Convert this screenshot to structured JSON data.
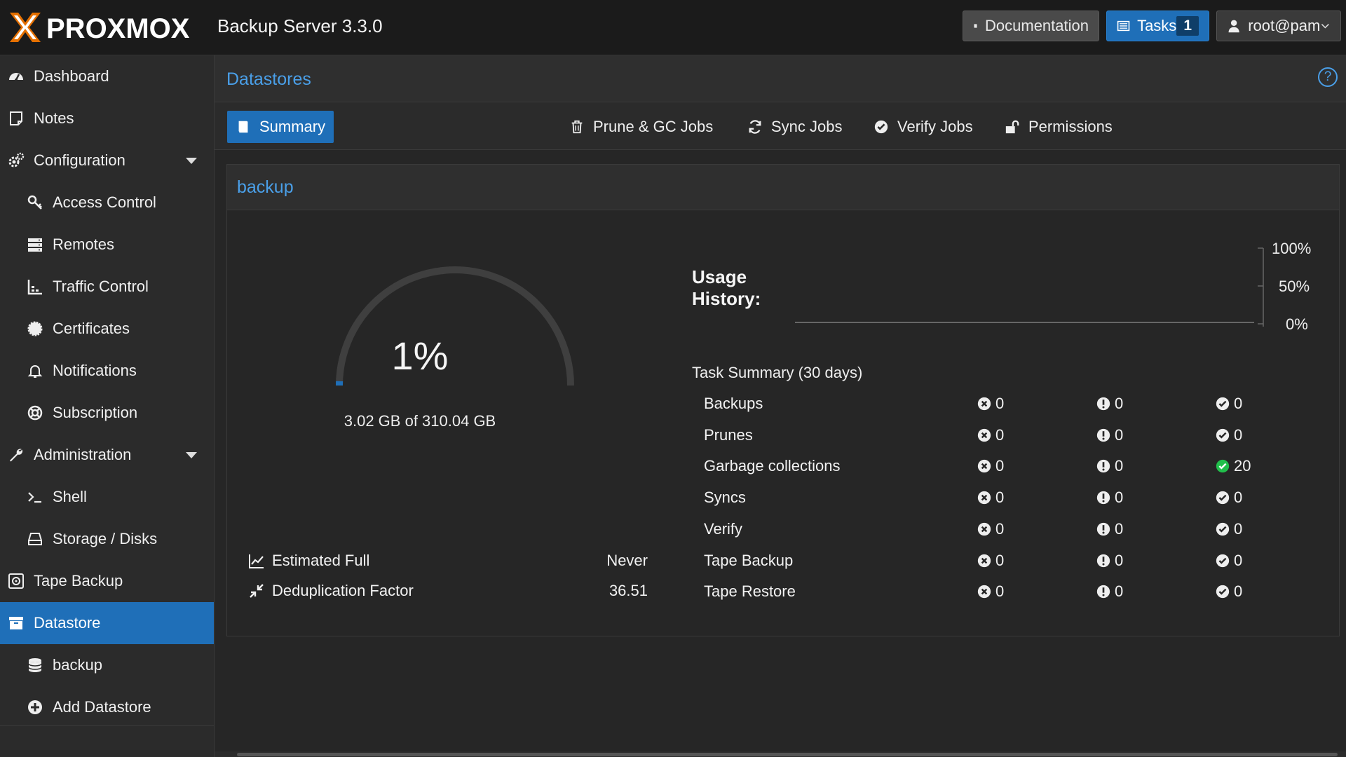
{
  "header": {
    "logo_text": "PROXMOX",
    "product": "Backup Server 3.3.0",
    "documentation_label": "Documentation",
    "tasks_label": "Tasks",
    "tasks_count": "1",
    "user_label": "root@pam"
  },
  "sidebar": {
    "items": [
      {
        "label": "Dashboard",
        "icon": "dashboard-icon"
      },
      {
        "label": "Notes",
        "icon": "notes-icon"
      },
      {
        "label": "Configuration",
        "icon": "gears-icon"
      },
      {
        "label": "Access Control",
        "icon": "key-icon"
      },
      {
        "label": "Remotes",
        "icon": "server-icon"
      },
      {
        "label": "Traffic Control",
        "icon": "traffic-icon"
      },
      {
        "label": "Certificates",
        "icon": "certificate-icon"
      },
      {
        "label": "Notifications",
        "icon": "bell-icon"
      },
      {
        "label": "Subscription",
        "icon": "lifebuoy-icon"
      },
      {
        "label": "Administration",
        "icon": "wrench-icon"
      },
      {
        "label": "Shell",
        "icon": "terminal-icon"
      },
      {
        "label": "Storage / Disks",
        "icon": "hdd-icon"
      },
      {
        "label": "Tape Backup",
        "icon": "tape-icon"
      },
      {
        "label": "Datastore",
        "icon": "archive-icon"
      },
      {
        "label": "backup",
        "icon": "database-icon"
      },
      {
        "label": "Add Datastore",
        "icon": "plus-circle-icon"
      }
    ]
  },
  "main": {
    "title": "Datastores",
    "help": "?",
    "tabs": [
      {
        "label": "Summary",
        "icon": "book-icon"
      },
      {
        "label": "Prune & GC Jobs",
        "icon": "trash-icon"
      },
      {
        "label": "Sync Jobs",
        "icon": "refresh-icon"
      },
      {
        "label": "Verify Jobs",
        "icon": "check-circle-icon"
      },
      {
        "label": "Permissions",
        "icon": "unlock-icon"
      }
    ]
  },
  "datastore": {
    "name": "backup",
    "usage_percent_label": "1%",
    "usage_fraction": 0.01,
    "usage_text": "3.02 GB of 310.04 GB",
    "estimated_full_label": "Estimated Full",
    "estimated_full_value": "Never",
    "dedup_label": "Deduplication Factor",
    "dedup_value": "36.51",
    "usage_history_label": "Usage History:",
    "usage_history_ticks": [
      "100%",
      "50%",
      "0%"
    ],
    "task_summary_title": "Task Summary (30 days)",
    "task_summary": [
      {
        "name": "Backups",
        "error": "0",
        "warning": "0",
        "ok": "0"
      },
      {
        "name": "Prunes",
        "error": "0",
        "warning": "0",
        "ok": "0"
      },
      {
        "name": "Garbage collections",
        "error": "0",
        "warning": "0",
        "ok": "20"
      },
      {
        "name": "Syncs",
        "error": "0",
        "warning": "0",
        "ok": "0"
      },
      {
        "name": "Verify",
        "error": "0",
        "warning": "0",
        "ok": "0"
      },
      {
        "name": "Tape Backup",
        "error": "0",
        "warning": "0",
        "ok": "0"
      },
      {
        "name": "Tape Restore",
        "error": "0",
        "warning": "0",
        "ok": "0"
      }
    ]
  },
  "colors": {
    "accent": "#1f6fb8",
    "link": "#4a9fe8",
    "ok_active": "#21bf4b",
    "logo_orange": "#e57000"
  }
}
